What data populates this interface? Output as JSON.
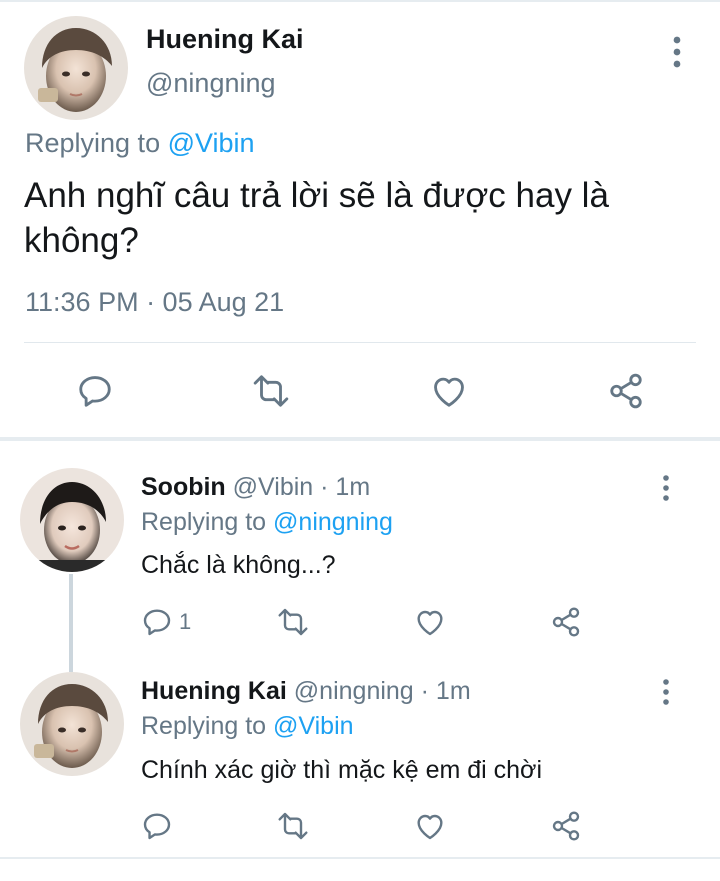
{
  "main_tweet": {
    "name": "Huening Kai",
    "handle": "@ningning",
    "replying_prefix": "Replying to ",
    "replying_to": "@Vibin",
    "text": "Anh nghĩ câu trả lời sẽ là được hay là không?",
    "timestamp": "11:36 PM · 05 Aug 21"
  },
  "replies": [
    {
      "name": "Soobin",
      "handle": "@Vibin",
      "time": " · 1m",
      "replying_prefix": "Replying to ",
      "replying_to": "@ningning",
      "text": "Chắc là không...?",
      "reply_count": "1"
    },
    {
      "name": "Huening Kai",
      "handle": "@ningning",
      "time": " · 1m",
      "replying_prefix": "Replying to ",
      "replying_to": "@Vibin",
      "text": "Chính xác giờ thì mặc kệ em đi chời"
    }
  ],
  "icons": [
    "reply-icon",
    "retweet-icon",
    "like-icon",
    "share-icon",
    "more-icon"
  ],
  "colors": {
    "accent": "#1da1f2",
    "muted": "#657786",
    "text": "#14171a",
    "divider": "#e6ecf0"
  }
}
